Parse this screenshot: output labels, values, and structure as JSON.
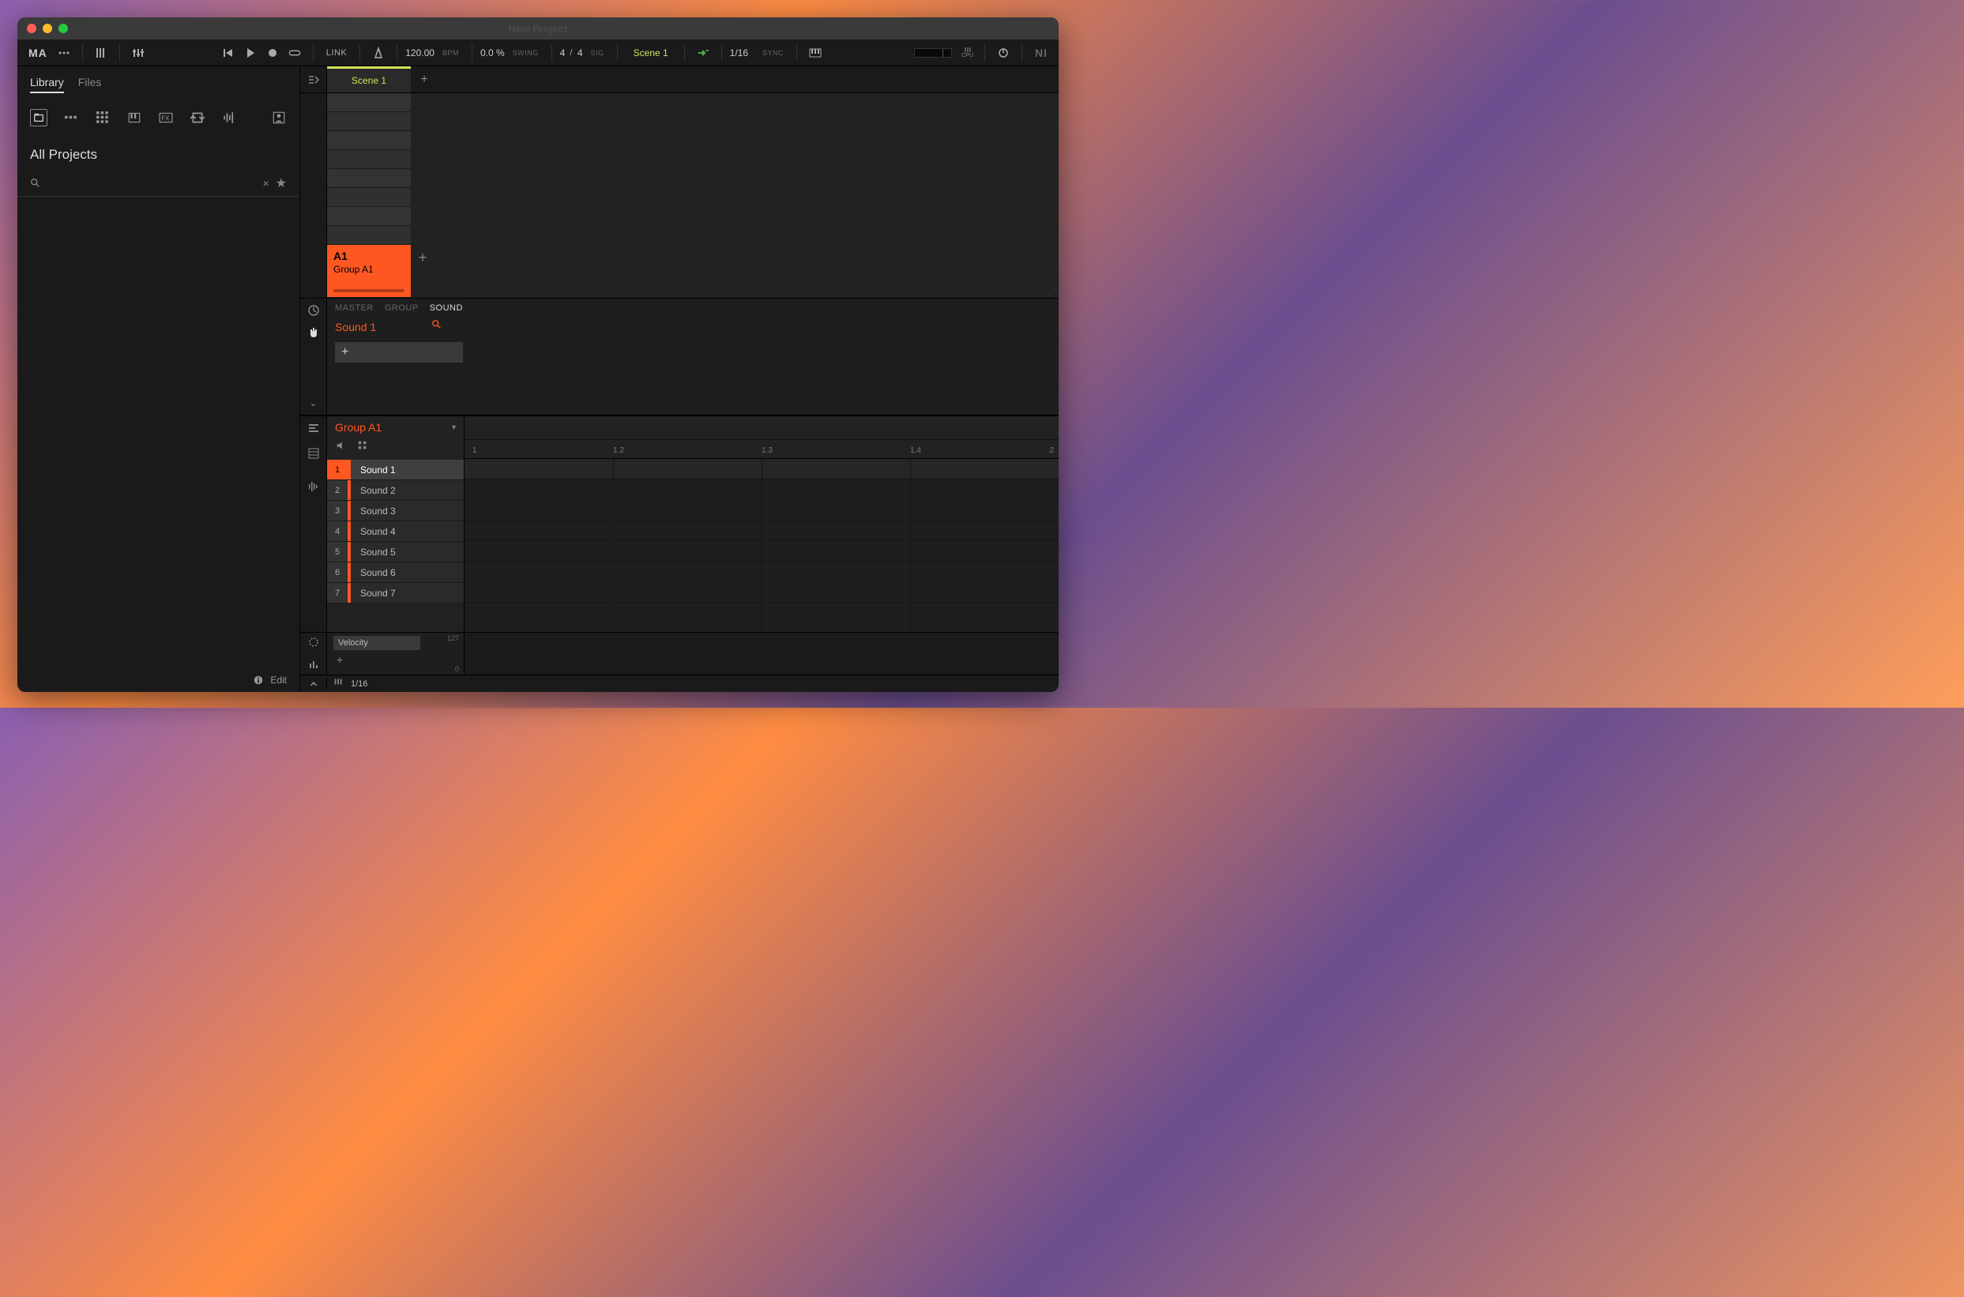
{
  "window": {
    "title": "New Project"
  },
  "toolbar": {
    "logo": "MA",
    "link": "LINK",
    "tempo": "120.00",
    "bpm": "BPM",
    "swing": "0.0 %",
    "swing_label": "SWING",
    "sig_n": "4",
    "sig_sep": "/",
    "sig_d": "4",
    "sig_label": "SIG",
    "scene": "Scene 1",
    "quantize": "1/16",
    "sync": "SYNC"
  },
  "browser": {
    "tabs": {
      "library": "Library",
      "files": "Files"
    },
    "heading": "All Projects",
    "edit": "Edit"
  },
  "scenes": {
    "scene1": "Scene 1"
  },
  "group": {
    "id": "A1",
    "name": "Group A1"
  },
  "sound_panel": {
    "tabs": {
      "master": "MASTER",
      "group": "GROUP",
      "sound": "SOUND"
    },
    "current": "Sound 1"
  },
  "pattern": {
    "group": "Group A1",
    "sounds": [
      {
        "n": "1",
        "name": "Sound 1"
      },
      {
        "n": "2",
        "name": "Sound 2"
      },
      {
        "n": "3",
        "name": "Sound 3"
      },
      {
        "n": "4",
        "name": "Sound 4"
      },
      {
        "n": "5",
        "name": "Sound 5"
      },
      {
        "n": "6",
        "name": "Sound 6"
      },
      {
        "n": "7",
        "name": "Sound 7"
      }
    ],
    "ruler": {
      "t1": "1",
      "t12": "1.2",
      "t13": "1.3",
      "t14": "1.4",
      "t2": "2"
    }
  },
  "velocity": {
    "label": "Velocity",
    "max": "127",
    "min": "0"
  },
  "footer": {
    "grid": "1/16"
  }
}
